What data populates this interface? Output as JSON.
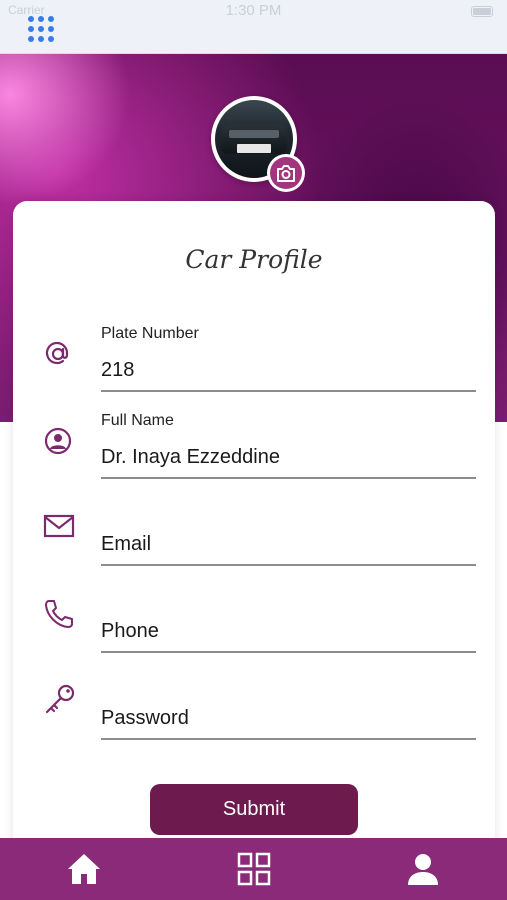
{
  "status_bar": {
    "time": "1:30 PM",
    "carrier": "Carrier"
  },
  "top_nav": {
    "menu_icon": "grid-dots-icon"
  },
  "profile": {
    "avatar_icon": "car-photo",
    "camera_icon": "camera-icon"
  },
  "card": {
    "title": "Car Profile"
  },
  "fields": [
    {
      "icon": "at-icon",
      "label": "Plate Number",
      "value": "218",
      "placeholder": ""
    },
    {
      "icon": "user-circle-icon",
      "label": "Full Name",
      "value": "Dr. Inaya Ezzeddine",
      "placeholder": ""
    },
    {
      "icon": "envelope-icon",
      "label": "",
      "value": "",
      "placeholder": "Email"
    },
    {
      "icon": "phone-icon",
      "label": "",
      "value": "",
      "placeholder": "Phone"
    },
    {
      "icon": "key-icon",
      "label": "",
      "value": "",
      "placeholder": "Password"
    }
  ],
  "submit": {
    "label": "Submit"
  },
  "tabbar": {
    "tabs": [
      {
        "icon": "home-icon"
      },
      {
        "icon": "grid-icon"
      },
      {
        "icon": "user-icon"
      }
    ]
  },
  "colors": {
    "accent": "#7b2a6e",
    "button": "#6d1b4f",
    "tabbar": "#8a2a79",
    "hero": "#5a0d52"
  }
}
